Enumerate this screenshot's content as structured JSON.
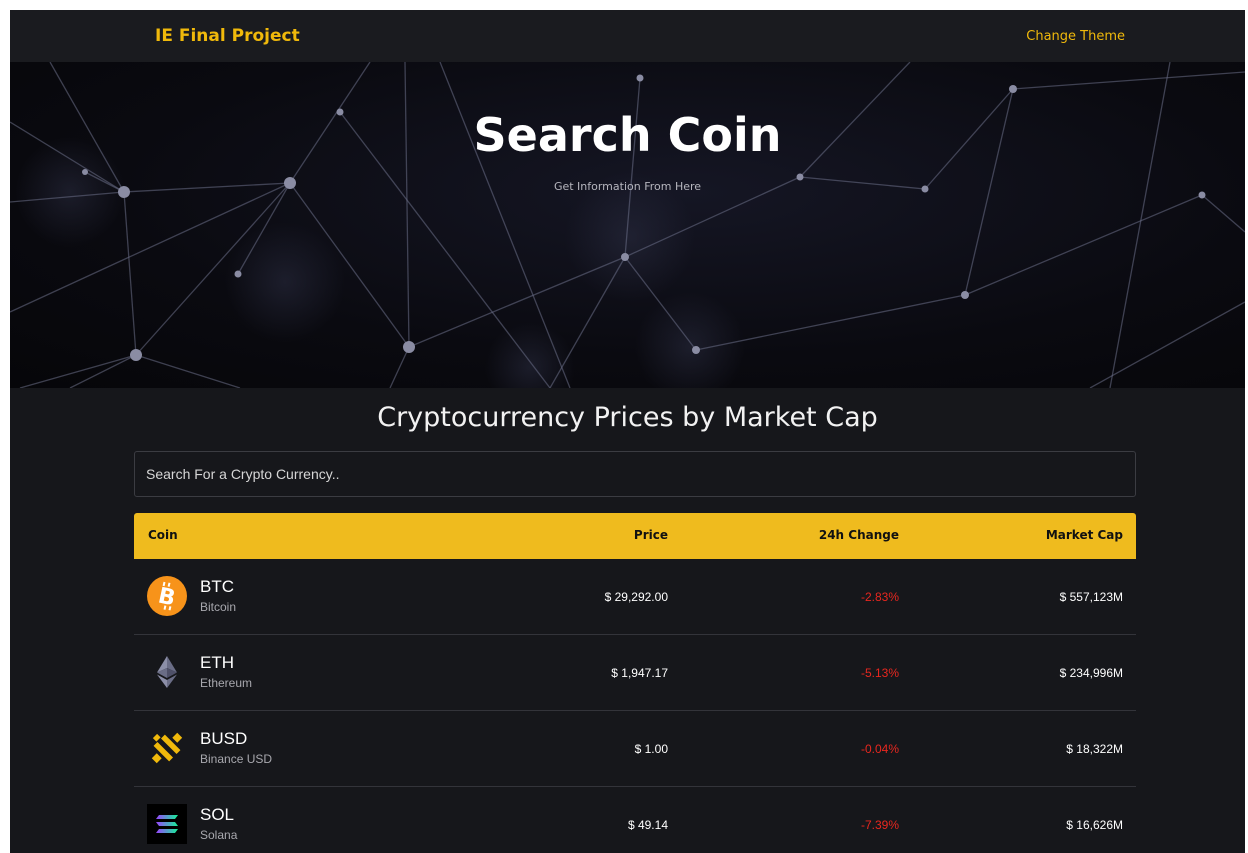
{
  "navbar": {
    "brand": "IE Final Project",
    "theme_link": "Change Theme"
  },
  "hero": {
    "title": "Search Coin",
    "subtitle": "Get Information From Here"
  },
  "main": {
    "section_title": "Cryptocurrency Prices by Market Cap",
    "search": {
      "placeholder": "Search For a Crypto Currency..",
      "value": ""
    },
    "table": {
      "columns": [
        "Coin",
        "Price",
        "24h Change",
        "Market Cap"
      ],
      "rows": [
        {
          "symbol": "BTC",
          "name": "Bitcoin",
          "price": "$ 29,292.00",
          "change": "-2.83%",
          "market_cap": "$ 557,123M",
          "icon": "bitcoin-icon"
        },
        {
          "symbol": "ETH",
          "name": "Ethereum",
          "price": "$ 1,947.17",
          "change": "-5.13%",
          "market_cap": "$ 234,996M",
          "icon": "ethereum-icon"
        },
        {
          "symbol": "BUSD",
          "name": "Binance USD",
          "price": "$ 1.00",
          "change": "-0.04%",
          "market_cap": "$ 18,322M",
          "icon": "binance-usd-icon"
        },
        {
          "symbol": "SOL",
          "name": "Solana",
          "price": "$ 49.14",
          "change": "-7.39%",
          "market_cap": "$ 16,626M",
          "icon": "solana-icon"
        }
      ]
    }
  },
  "colors": {
    "accent": "#f0b90b",
    "header_bg": "#efbb1e",
    "background": "#16171b",
    "negative": "#e8271f"
  }
}
